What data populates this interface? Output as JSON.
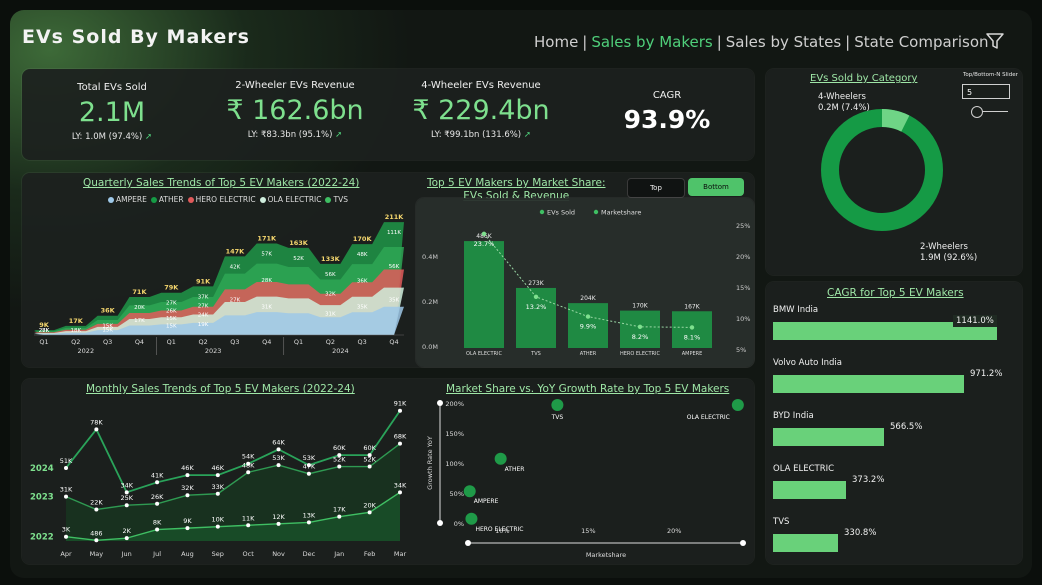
{
  "header": {
    "title": "EVs Sold By Makers"
  },
  "nav": {
    "home": "Home",
    "sep": "|",
    "makers": "Sales by Makers",
    "states": "Sales by States",
    "comparison": "State Comparison"
  },
  "kpis": {
    "total": {
      "label": "Total EVs Sold",
      "value": "2.1M",
      "ly": "LY: 1.0M (97.4%)"
    },
    "two": {
      "label": "2-Wheeler EVs Revenue",
      "value": "₹ 162.6bn",
      "ly": "LY: ₹83.3bn (95.1%)"
    },
    "four": {
      "label": "4-Wheeler EVs Revenue",
      "value": "₹ 229.4bn",
      "ly": "LY: ₹99.1bn (131.6%)"
    },
    "cagr": {
      "label": "CAGR",
      "value": "93.9%"
    },
    "arrow": "➚"
  },
  "category": {
    "title": "EVs Sold by Category",
    "four_label": "4-Wheelers",
    "four_value": "0.2M (7.4%)",
    "two_label": "2-Wheelers",
    "two_value": "1.9M (92.6%)",
    "four_share": 0.074,
    "slider_label": "Top/Bottom-N Slider",
    "slider_value": "5",
    "colors": {
      "two": "#159a45",
      "four": "#6fd486"
    }
  },
  "quarterly": {
    "title": "Quarterly Sales Trends of Top 5 EV Makers (2022-24)",
    "legend": [
      {
        "name": "AMPERE",
        "color": "#9ec8e8"
      },
      {
        "name": "ATHER",
        "color": "#159a45"
      },
      {
        "name": "HERO ELECTRIC",
        "color": "#e05a5a"
      },
      {
        "name": "OLA ELECTRIC",
        "color": "#cfeedd"
      },
      {
        "name": "TVS",
        "color": "#3fbf63"
      }
    ],
    "quarters": [
      "Q1",
      "Q2",
      "Q3",
      "Q4",
      "Q1",
      "Q2",
      "Q3",
      "Q4",
      "Q1",
      "Q2",
      "Q3",
      "Q4"
    ],
    "years": [
      "2022",
      "2023",
      "2024"
    ],
    "totals": [
      "9K",
      "17K",
      "36K",
      "71K",
      "79K",
      "91K",
      "147K",
      "171K",
      "163K",
      "133K",
      "170K",
      "211K"
    ],
    "total_values": [
      9,
      17,
      36,
      71,
      79,
      91,
      147,
      171,
      163,
      133,
      170,
      211
    ],
    "inner_labels": [
      [
        "27K",
        "28K"
      ],
      [
        "18K"
      ],
      [
        "15K",
        "15K"
      ],
      [
        "20K",
        "17K"
      ],
      [
        "27K",
        "26K",
        "15K",
        "15K"
      ],
      [
        "37K",
        "27K",
        "24K",
        "19K"
      ],
      [
        "42K",
        "27K"
      ],
      [
        "57K",
        "28K",
        "31K"
      ],
      [
        "52K"
      ],
      [
        "56K",
        "32K",
        "31K"
      ],
      [
        "48K",
        "36K",
        "35K"
      ],
      [
        "111K",
        "56K",
        "35K"
      ]
    ],
    "chart_data": {
      "type": "area",
      "categories": [
        "2022 Q1",
        "2022 Q2",
        "2022 Q3",
        "2022 Q4",
        "2023 Q1",
        "2023 Q2",
        "2023 Q3",
        "2023 Q4",
        "2024 Q1",
        "2024 Q2",
        "2024 Q3",
        "2024 Q4"
      ],
      "totals": [
        9,
        17,
        36,
        71,
        79,
        91,
        147,
        171,
        163,
        133,
        170,
        211
      ],
      "unit": "K"
    }
  },
  "market_share": {
    "title_line1": "Top 5 EV Makers by Market Share:",
    "title_line2": "EVs Sold & Revenue",
    "toggle_top": "Top",
    "toggle_bottom": "Bottom",
    "legend_sold": "EVs Sold",
    "legend_share": "Marketshare",
    "chart_data": {
      "type": "bar",
      "categories": [
        "OLA ELECTRIC",
        "TVS",
        "ATHER",
        "HERO ELECTRIC",
        "AMPERE"
      ],
      "sold_labels": [
        "486K",
        "273K",
        "204K",
        "170K",
        "167K"
      ],
      "sold": [
        486,
        273,
        204,
        170,
        167
      ],
      "share_labels": [
        "23.7%",
        "13.2%",
        "9.9%",
        "8.2%",
        "8.1%"
      ],
      "share": [
        23.7,
        13.2,
        9.9,
        8.2,
        8.1
      ],
      "left_ticks": [
        "0.4M",
        "0.2M",
        "0.0M"
      ],
      "right_ticks": [
        "25%",
        "20%",
        "15%",
        "10%",
        "5%"
      ]
    }
  },
  "monthly": {
    "title": "Monthly Sales Trends of Top 5 EV Makers (2022-24)",
    "chart_data": {
      "type": "line",
      "months": [
        "Apr",
        "May",
        "Jun",
        "Jul",
        "Aug",
        "Sep",
        "Oct",
        "Nov",
        "Dec",
        "Jan",
        "Feb",
        "Mar"
      ],
      "series": [
        {
          "name": "2024",
          "labels": [
            "51K",
            "78K",
            "34K",
            "41K",
            "46K",
            "46K",
            "54K",
            "64K",
            "53K",
            "60K",
            "60K",
            "91K"
          ],
          "values": [
            51,
            78,
            34,
            41,
            46,
            46,
            54,
            64,
            53,
            60,
            60,
            91
          ]
        },
        {
          "name": "2023",
          "labels": [
            "31K",
            "22K",
            "25K",
            "26K",
            "32K",
            "33K",
            "48K",
            "53K",
            "47K",
            "52K",
            "52K",
            "68K"
          ],
          "values": [
            31,
            22,
            25,
            26,
            32,
            33,
            48,
            53,
            47,
            52,
            52,
            68
          ]
        },
        {
          "name": "2022",
          "labels": [
            "3K",
            "486",
            "2K",
            "8K",
            "9K",
            "10K",
            "11K",
            "12K",
            "13K",
            "17K",
            "20K",
            "34K"
          ],
          "values": [
            3,
            0.5,
            2,
            8,
            9,
            10,
            11,
            12,
            13,
            17,
            20,
            34
          ]
        }
      ]
    }
  },
  "scatter": {
    "title": "Market Share vs. YoY Growth Rate by Top 5 EV Makers",
    "ylabel": "Growth Rate YoY",
    "xlabel": "Marketshare",
    "y_ticks": [
      "200%",
      "150%",
      "100%",
      "50%",
      "0%"
    ],
    "x_ticks": [
      "10%",
      "15%",
      "20%"
    ],
    "chart_data": {
      "type": "scatter",
      "points": [
        {
          "name": "TVS",
          "x": 13.2,
          "y": 200
        },
        {
          "name": "OLA ELECTRIC",
          "x": 23.7,
          "y": 200
        },
        {
          "name": "ATHER",
          "x": 9.9,
          "y": 107
        },
        {
          "name": "AMPERE",
          "x": 8.1,
          "y": 53
        },
        {
          "name": "HERO ELECTRIC",
          "x": 8.2,
          "y": 7
        }
      ]
    }
  },
  "cagr_makers": {
    "title": "CAGR for Top 5 EV Makers",
    "items": [
      {
        "name": "BMW India",
        "pct": "1141.0%",
        "value": 1141.0
      },
      {
        "name": "Volvo Auto India",
        "pct": "971.2%",
        "value": 971.2
      },
      {
        "name": "BYD India",
        "pct": "566.5%",
        "value": 566.5
      },
      {
        "name": "OLA ELECTRIC",
        "pct": "373.2%",
        "value": 373.2
      },
      {
        "name": "TVS",
        "pct": "330.8%",
        "value": 330.8
      }
    ]
  }
}
